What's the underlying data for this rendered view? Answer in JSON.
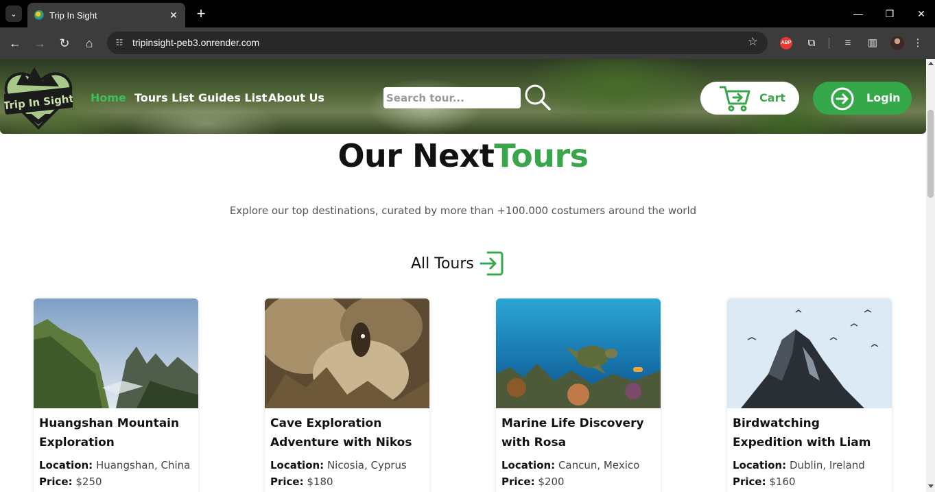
{
  "browser": {
    "tab_title": "Trip In Sight",
    "url": "tripinsight-peb3.onrender.com",
    "extensions": [
      "abp-icon",
      "puzzle-icon",
      "media-icon",
      "sidepanel-icon",
      "profile-avatar"
    ]
  },
  "header": {
    "logo_text": "Trip In Sight",
    "nav": [
      {
        "label": "Home",
        "active": true
      },
      {
        "label": "Tours List",
        "active": false
      },
      {
        "label": "Guides List",
        "active": false
      },
      {
        "label": "About Us",
        "active": false
      }
    ],
    "search_placeholder": "Search tour...",
    "cart_label": "Cart",
    "login_label": "Login"
  },
  "hero": {
    "title_main": "Our Next",
    "title_accent": "Tours",
    "subtitle": "Explore our top destinations, curated by more than +100.000 costumers around the world",
    "all_tours_label": "All Tours"
  },
  "tours": [
    {
      "title": "Huangshan Mountain Exploration",
      "location_label": "Location:",
      "location": "Huangshan, China",
      "price_label": "Price:",
      "price": "$250"
    },
    {
      "title": "Cave Exploration Adventure with Nikos",
      "location_label": "Location:",
      "location": "Nicosia, Cyprus",
      "price_label": "Price:",
      "price": "$180"
    },
    {
      "title": "Marine Life Discovery with Rosa",
      "location_label": "Location:",
      "location": "Cancun, Mexico",
      "price_label": "Price:",
      "price": "$200"
    },
    {
      "title": "Birdwatching Expedition with Liam",
      "location_label": "Location:",
      "location": "Dublin, Ireland",
      "price_label": "Price:",
      "price": "$160"
    }
  ],
  "colors": {
    "accent_green": "#3aa64c",
    "nav_active": "#3fbd5a",
    "login_bg": "#35a84a"
  }
}
